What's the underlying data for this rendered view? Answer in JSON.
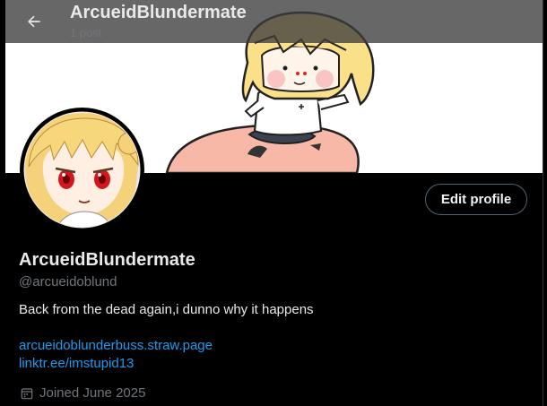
{
  "header": {
    "title": "ArcueidBlundermate",
    "post_count": "1 post",
    "back_icon": "arrow-left-icon"
  },
  "profile": {
    "display_name": "ArcueidBlundermate",
    "handle": "@arcueidoblund",
    "bio": "Back from the dead again,i dunno why it happens",
    "links": [
      "arcueidoblunderbuss.straw.page",
      "linktr.ee/imstupid13"
    ],
    "joined": "Joined June 2025",
    "joined_icon": "calendar-icon",
    "edit_label": "Edit profile"
  },
  "colors": {
    "background": "#000000",
    "text": "#e7e9ea",
    "muted": "#71767b",
    "link": "#1d9bf0",
    "button_border": "#536471"
  }
}
